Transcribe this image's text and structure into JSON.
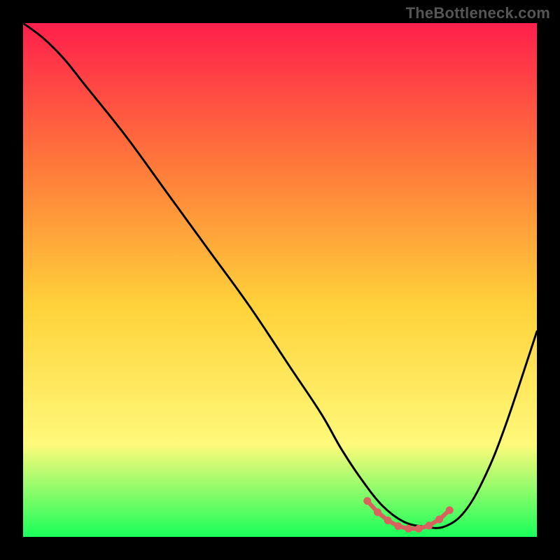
{
  "watermark": "TheBottleneck.com",
  "colors": {
    "background": "#000000",
    "gradient_top": "#ff1f4b",
    "gradient_mid_upper": "#ff7a3a",
    "gradient_mid": "#ffd23a",
    "gradient_mid_lower": "#fff97a",
    "gradient_bottom": "#19ff5a",
    "curve": "#000000",
    "marker": "#d9625f"
  },
  "chart_data": {
    "type": "line",
    "title": "",
    "xlabel": "",
    "ylabel": "",
    "xlim": [
      0,
      100
    ],
    "ylim": [
      0,
      100
    ],
    "series": [
      {
        "name": "bottleneck-curve",
        "x": [
          0,
          4,
          8,
          12,
          20,
          28,
          36,
          44,
          52,
          58,
          62,
          66,
          70,
          74,
          78,
          82,
          86,
          90,
          94,
          100
        ],
        "y": [
          100,
          97,
          93,
          88,
          78,
          67,
          56,
          45,
          33,
          24,
          17,
          11,
          6,
          3,
          2,
          2,
          5,
          12,
          22,
          40
        ]
      }
    ],
    "markers": {
      "name": "optimal-range",
      "x": [
        67,
        69,
        71,
        73,
        75,
        77,
        79,
        81,
        83
      ],
      "y": [
        7.0,
        4.8,
        3.2,
        2.1,
        1.6,
        1.6,
        2.2,
        3.4,
        5.2
      ]
    }
  }
}
